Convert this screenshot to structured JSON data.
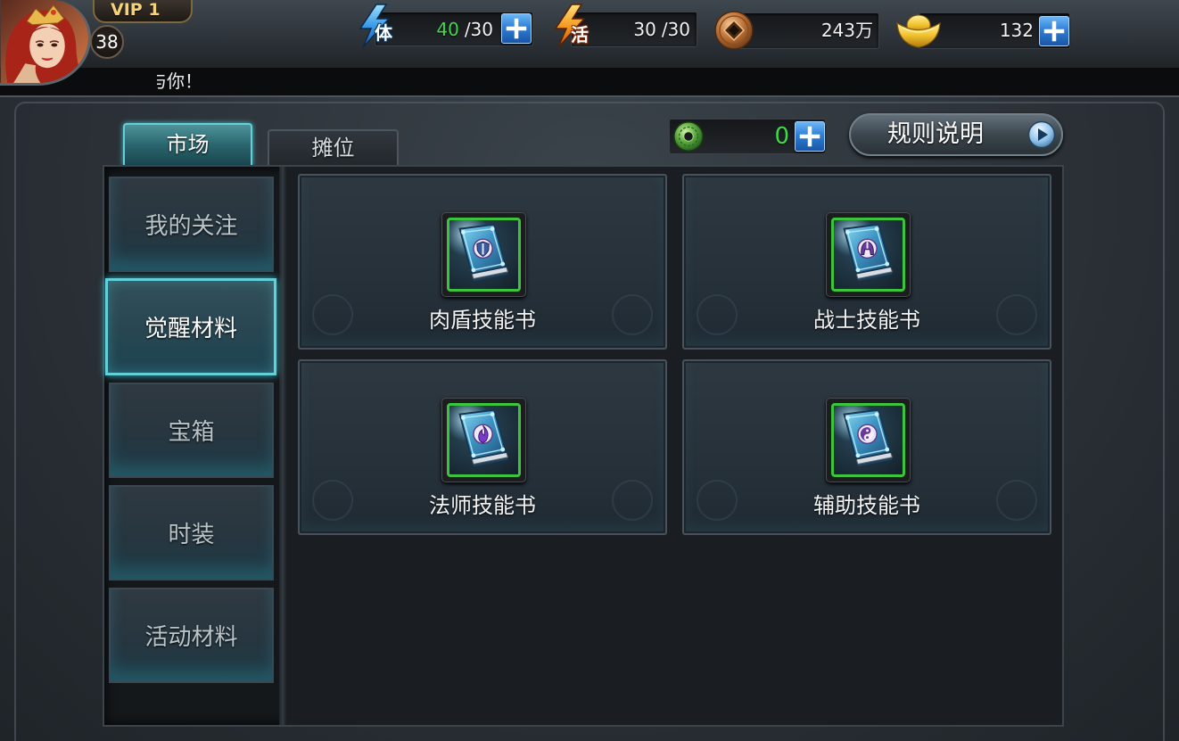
{
  "player": {
    "avatar": "hero-portrait-icon",
    "vip": "VIP 1",
    "level": "38"
  },
  "resources": {
    "stamina": {
      "icon": "stamina-lightning-icon",
      "glyph": "体",
      "current": "40",
      "max": "/30",
      "add_icon": "plus-icon"
    },
    "activity": {
      "icon": "activity-lightning-icon",
      "glyph": "活",
      "current": "30",
      "max": "/30"
    },
    "coins": {
      "icon": "copper-coin-icon",
      "value": "243万"
    },
    "gold": {
      "icon": "gold-ingot-icon",
      "value": "132",
      "add_icon": "plus-icon"
    }
  },
  "marquee": {
    "text": "与你！"
  },
  "market": {
    "tabs": [
      {
        "label": "市场",
        "active": true
      },
      {
        "label": "摊位",
        "active": false
      }
    ],
    "jade": {
      "icon": "jade-coin-icon",
      "value": "0",
      "add_icon": "plus-icon"
    },
    "rules_button": {
      "label": "规则说明",
      "icon": "play-arrow-icon"
    },
    "categories": [
      {
        "label": "我的关注",
        "active": false
      },
      {
        "label": "觉醒材料",
        "active": true
      },
      {
        "label": "宝箱",
        "active": false
      },
      {
        "label": "时装",
        "active": false
      },
      {
        "label": "活动材料",
        "active": false
      }
    ],
    "items": [
      {
        "label": "肉盾技能书",
        "icon": "tank-skill-book-icon"
      },
      {
        "label": "战士技能书",
        "icon": "warrior-skill-book-icon"
      },
      {
        "label": "法师技能书",
        "icon": "mage-skill-book-icon"
      },
      {
        "label": "辅助技能书",
        "icon": "support-skill-book-icon"
      }
    ]
  },
  "colors": {
    "positive_value": "#3fd94a",
    "active_border": "#63cfd8",
    "item_frame": "#3cc43c",
    "vip_text": "#f3d27a"
  }
}
